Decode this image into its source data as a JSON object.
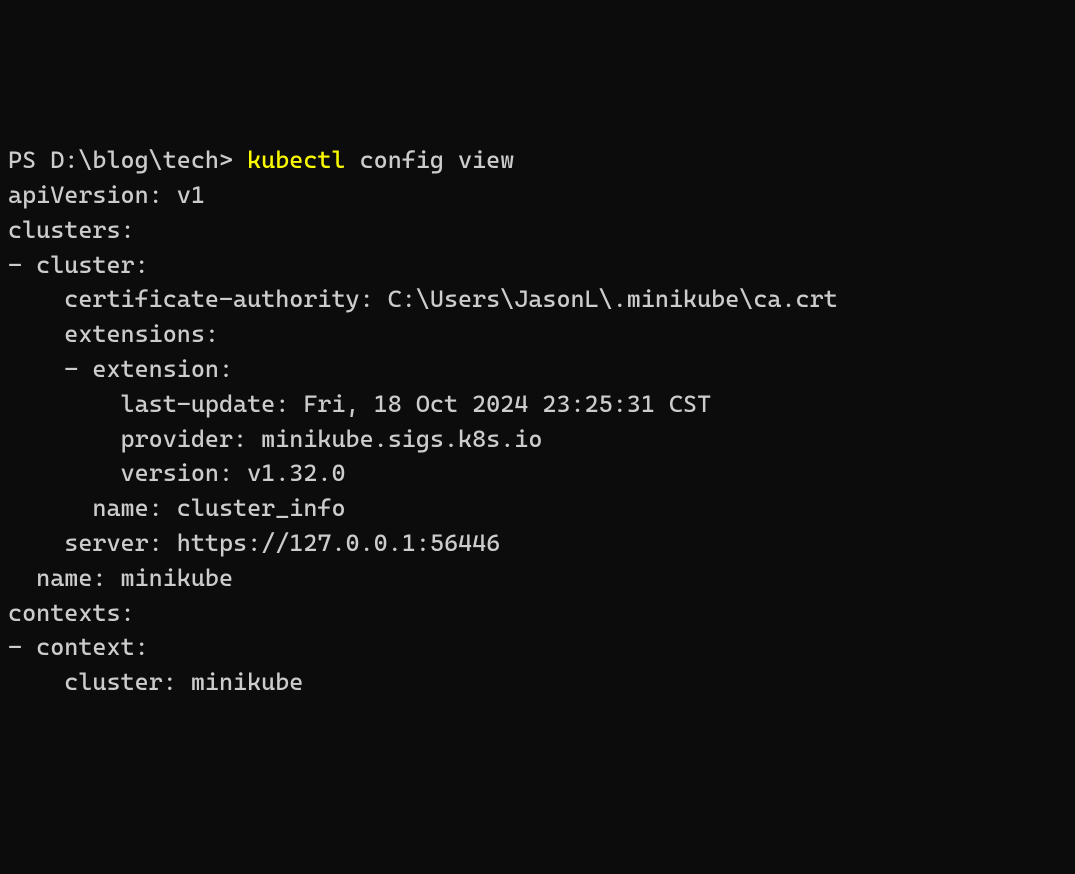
{
  "prompt": {
    "prefix": "PS D:\\blog\\tech> ",
    "command": "kubectl",
    "args": " config view"
  },
  "output": {
    "lines": [
      "apiVersion: v1",
      "clusters:",
      "- cluster:",
      "    certificate-authority: C:\\Users\\JasonL\\.minikube\\ca.crt",
      "    extensions:",
      "    - extension:",
      "        last-update: Fri, 18 Oct 2024 23:25:31 CST",
      "        provider: minikube.sigs.k8s.io",
      "        version: v1.32.0",
      "      name: cluster_info",
      "    server: https://127.0.0.1:56446",
      "  name: minikube",
      "contexts:",
      "- context:",
      "    cluster: minikube"
    ]
  }
}
